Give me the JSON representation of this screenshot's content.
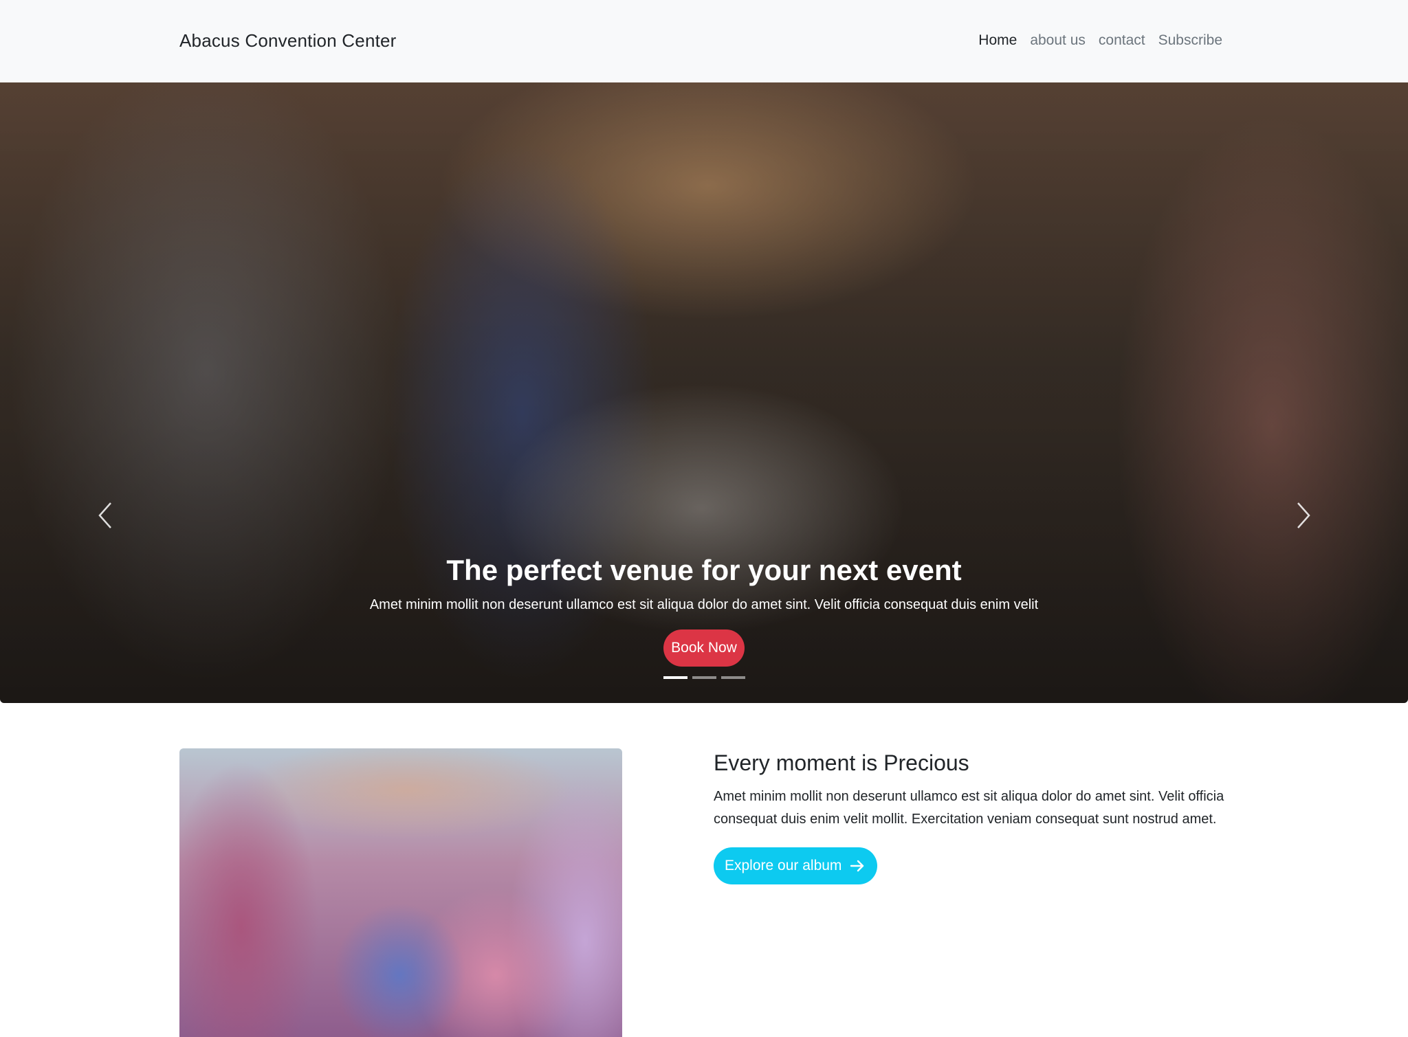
{
  "navbar": {
    "brand": "Abacus Convention Center",
    "links": [
      {
        "label": "Home",
        "active": true
      },
      {
        "label": "about us",
        "active": false
      },
      {
        "label": "contact",
        "active": false
      },
      {
        "label": "Subscribe",
        "active": false
      }
    ]
  },
  "hero": {
    "title": "The perfect venue for your next event",
    "subtitle": "Amet minim mollit non deserunt ullamco est sit aliqua dolor do amet sint. Velit officia consequat duis enim velit",
    "cta_label": "Book Now",
    "slides_total": 3,
    "active_slide": 1,
    "prev_icon": "chevron-left-icon",
    "next_icon": "chevron-right-icon"
  },
  "about": {
    "title": "Every moment is Precious",
    "body": "Amet minim mollit non deserunt ullamco est sit aliqua dolor do amet sint. Velit officia consequat duis enim velit mollit. Exercitation veniam consequat sunt nostrud amet.",
    "cta_label": "Explore our album",
    "cta_icon": "arrow-right-icon"
  },
  "colors": {
    "navbar_bg": "#f8f9fa",
    "book_button": "#dc3545",
    "explore_button": "#0dcaf0"
  }
}
